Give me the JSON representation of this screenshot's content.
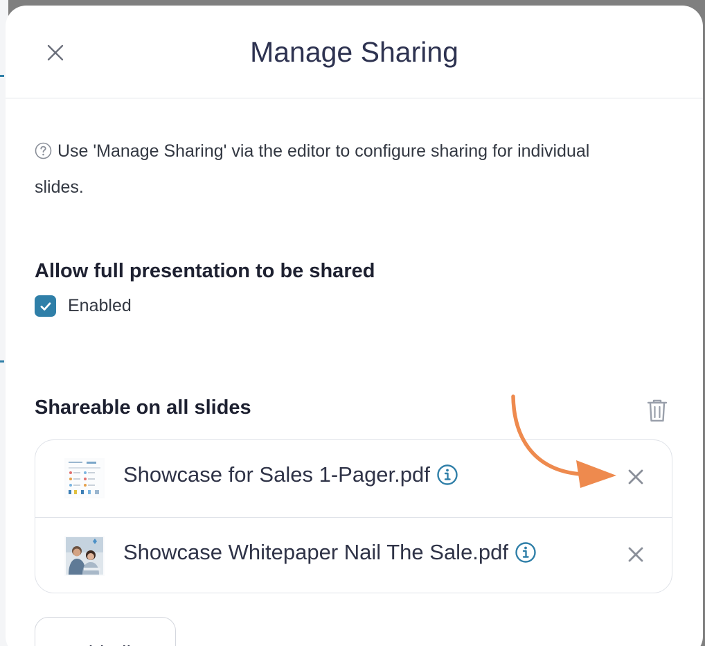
{
  "modal": {
    "title": "Manage Sharing",
    "help_text": "Use 'Manage Sharing' via the editor to configure sharing for individual slides."
  },
  "full_presentation": {
    "heading": "Allow full presentation to be shared",
    "checkbox_label": "Enabled",
    "checked": true
  },
  "shareable": {
    "heading": "Shareable on all slides",
    "files": [
      {
        "name": "Showcase for Sales 1-Pager.pdf",
        "thumb_icon": "pdf-page-thumbnail"
      },
      {
        "name": "Showcase Whitepaper Nail The Sale.pdf",
        "thumb_icon": "photo-thumbnail"
      }
    ],
    "add_button": "Add File"
  },
  "colors": {
    "accent": "#2f7fa8",
    "annotation_arrow": "#ee8a4e",
    "title": "#2d3250"
  }
}
